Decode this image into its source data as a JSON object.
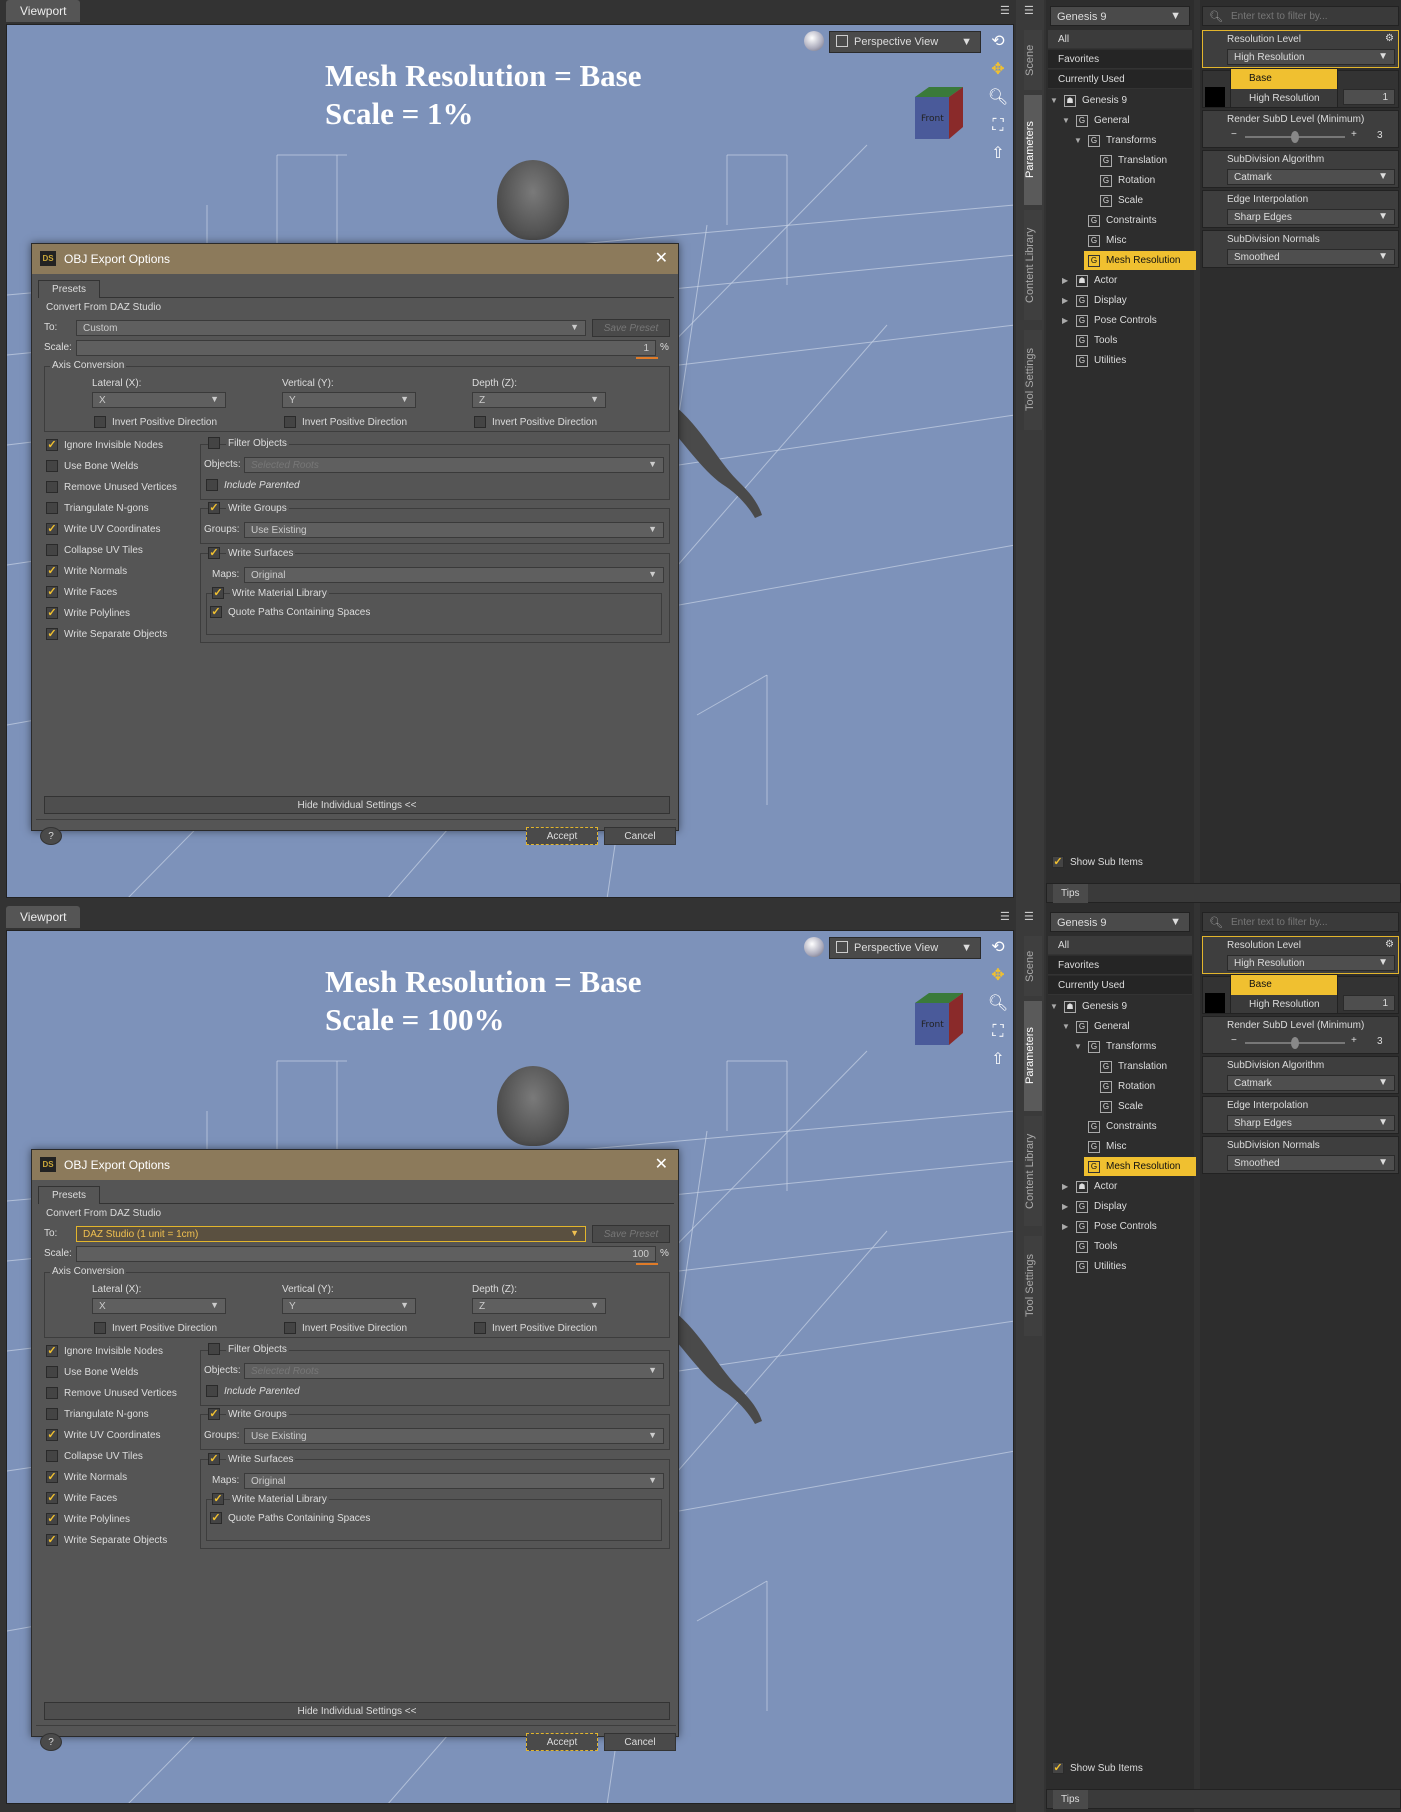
{
  "panels": [
    {
      "viewport_tab": "Viewport",
      "annotation": {
        "line1": "Mesh Resolution = Base",
        "line2": "Scale = 1%"
      },
      "perspective_label": "Perspective View",
      "cube_label": "Front",
      "dialog": {
        "title": "OBJ Export Options",
        "tab": "Presets",
        "convert_from": "Convert From DAZ Studio",
        "to_label": "To:",
        "to_value": "Custom",
        "to_highlight": false,
        "save_preset": "Save Preset",
        "scale_label": "Scale:",
        "scale_value": "1",
        "scale_unit": "%",
        "axis_conversion": "Axis Conversion",
        "lateral_label": "Lateral (X):",
        "lateral_value": "X",
        "vertical_label": "Vertical (Y):",
        "vertical_value": "Y",
        "depth_label": "Depth (Z):",
        "depth_value": "Z",
        "invert_label": "Invert Positive Direction",
        "options": [
          {
            "label": "Ignore Invisible Nodes",
            "checked": true
          },
          {
            "label": "Use Bone Welds",
            "checked": false
          },
          {
            "label": "Remove Unused Vertices",
            "checked": false
          },
          {
            "label": "Triangulate N-gons",
            "checked": false
          },
          {
            "label": "Write UV Coordinates",
            "checked": true
          },
          {
            "label": "Collapse UV Tiles",
            "checked": false
          },
          {
            "label": "Write Normals",
            "checked": true
          },
          {
            "label": "Write Faces",
            "checked": true
          },
          {
            "label": "Write Polylines",
            "checked": true
          },
          {
            "label": "Write Separate Objects",
            "checked": true
          }
        ],
        "filter_objects": "Filter Objects",
        "objects_label": "Objects:",
        "objects_value": "Selected Roots",
        "include_parented": "Include Parented",
        "write_groups": "Write Groups",
        "groups_label": "Groups:",
        "groups_value": "Use Existing",
        "write_surfaces": "Write Surfaces",
        "maps_label": "Maps:",
        "maps_value": "Original",
        "write_material_library": "Write Material Library",
        "quote_paths": "Quote Paths Containing Spaces",
        "hide_settings": "Hide Individual Settings <<",
        "help": "?",
        "accept": "Accept",
        "cancel": "Cancel"
      }
    },
    {
      "viewport_tab": "Viewport",
      "annotation": {
        "line1": "Mesh Resolution = Base",
        "line2": "Scale = 100%"
      },
      "perspective_label": "Perspective View",
      "cube_label": "Front",
      "dialog": {
        "title": "OBJ Export Options",
        "tab": "Presets",
        "convert_from": "Convert From DAZ Studio",
        "to_label": "To:",
        "to_value": "DAZ Studio (1 unit = 1cm)",
        "to_highlight": true,
        "save_preset": "Save Preset",
        "scale_label": "Scale:",
        "scale_value": "100",
        "scale_unit": "%",
        "axis_conversion": "Axis Conversion",
        "lateral_label": "Lateral (X):",
        "lateral_value": "X",
        "vertical_label": "Vertical (Y):",
        "vertical_value": "Y",
        "depth_label": "Depth (Z):",
        "depth_value": "Z",
        "invert_label": "Invert Positive Direction",
        "options": [
          {
            "label": "Ignore Invisible Nodes",
            "checked": true
          },
          {
            "label": "Use Bone Welds",
            "checked": false
          },
          {
            "label": "Remove Unused Vertices",
            "checked": false
          },
          {
            "label": "Triangulate N-gons",
            "checked": false
          },
          {
            "label": "Write UV Coordinates",
            "checked": true
          },
          {
            "label": "Collapse UV Tiles",
            "checked": false
          },
          {
            "label": "Write Normals",
            "checked": true
          },
          {
            "label": "Write Faces",
            "checked": true
          },
          {
            "label": "Write Polylines",
            "checked": true
          },
          {
            "label": "Write Separate Objects",
            "checked": true
          }
        ],
        "filter_objects": "Filter Objects",
        "objects_label": "Objects:",
        "objects_value": "Selected Roots",
        "include_parented": "Include Parented",
        "write_groups": "Write Groups",
        "groups_label": "Groups:",
        "groups_value": "Use Existing",
        "write_surfaces": "Write Surfaces",
        "maps_label": "Maps:",
        "maps_value": "Original",
        "write_material_library": "Write Material Library",
        "quote_paths": "Quote Paths Containing Spaces",
        "hide_settings": "Hide Individual Settings <<",
        "help": "?",
        "accept": "Accept",
        "cancel": "Cancel"
      }
    }
  ],
  "side_tabs": [
    "Scene",
    "Parameters",
    "Content Library",
    "Tool Settings"
  ],
  "scene": {
    "figure": "Genesis 9",
    "categories": [
      "All",
      "Favorites",
      "Currently Used"
    ],
    "nodes": [
      {
        "label": "Genesis 9",
        "dim": true,
        "arrow": "down",
        "icon": "figure"
      },
      {
        "label": "General",
        "dim": true,
        "arrow": "down",
        "icon": "G"
      },
      {
        "label": "Transforms",
        "dim": true,
        "arrow": "down",
        "icon": "G"
      },
      {
        "label": "Translation",
        "dim": false,
        "arrow": "",
        "icon": "G"
      },
      {
        "label": "Rotation",
        "dim": false,
        "arrow": "",
        "icon": "G"
      },
      {
        "label": "Scale",
        "dim": false,
        "arrow": "",
        "icon": "G"
      },
      {
        "label": "Constraints",
        "dim": false,
        "arrow": "",
        "icon": "G"
      },
      {
        "label": "Misc",
        "dim": false,
        "arrow": "",
        "icon": "G"
      },
      {
        "label": "Mesh Resolution",
        "dim": false,
        "arrow": "",
        "icon": "G",
        "selected": true
      },
      {
        "label": "Actor",
        "dim": true,
        "arrow": "right",
        "icon": "figure"
      },
      {
        "label": "Display",
        "dim": false,
        "arrow": "right",
        "icon": "G"
      },
      {
        "label": "Pose Controls",
        "dim": true,
        "arrow": "right",
        "icon": "G"
      },
      {
        "label": "Tools",
        "dim": false,
        "arrow": "",
        "icon": "G"
      },
      {
        "label": "Utilities",
        "dim": false,
        "arrow": "",
        "icon": "G"
      }
    ],
    "show_sub_items": "Show Sub Items",
    "tips": "Tips"
  },
  "params": {
    "filter_placeholder": "Enter text to filter by...",
    "resolution_level_title": "Resolution Level",
    "resolution_level_value": "High Resolution",
    "popup_options": [
      "Base",
      "High Resolution"
    ],
    "popup_selected": "Base",
    "subd_value": "1",
    "render_subd_title": "Render SubD Level (Minimum)",
    "render_subd_value": "3",
    "subd_algo_title": "SubDivision Algorithm",
    "subd_algo_value": "Catmark",
    "edge_interp_title": "Edge Interpolation",
    "edge_interp_value": "Sharp Edges",
    "subd_normals_title": "SubDivision Normals",
    "subd_normals_value": "Smoothed"
  },
  "colors": {
    "accent": "#f0c030",
    "viewport_bg": "#7d92ba",
    "dialog_title": "#8c7a5b",
    "scale_bar": "#e07b28"
  }
}
